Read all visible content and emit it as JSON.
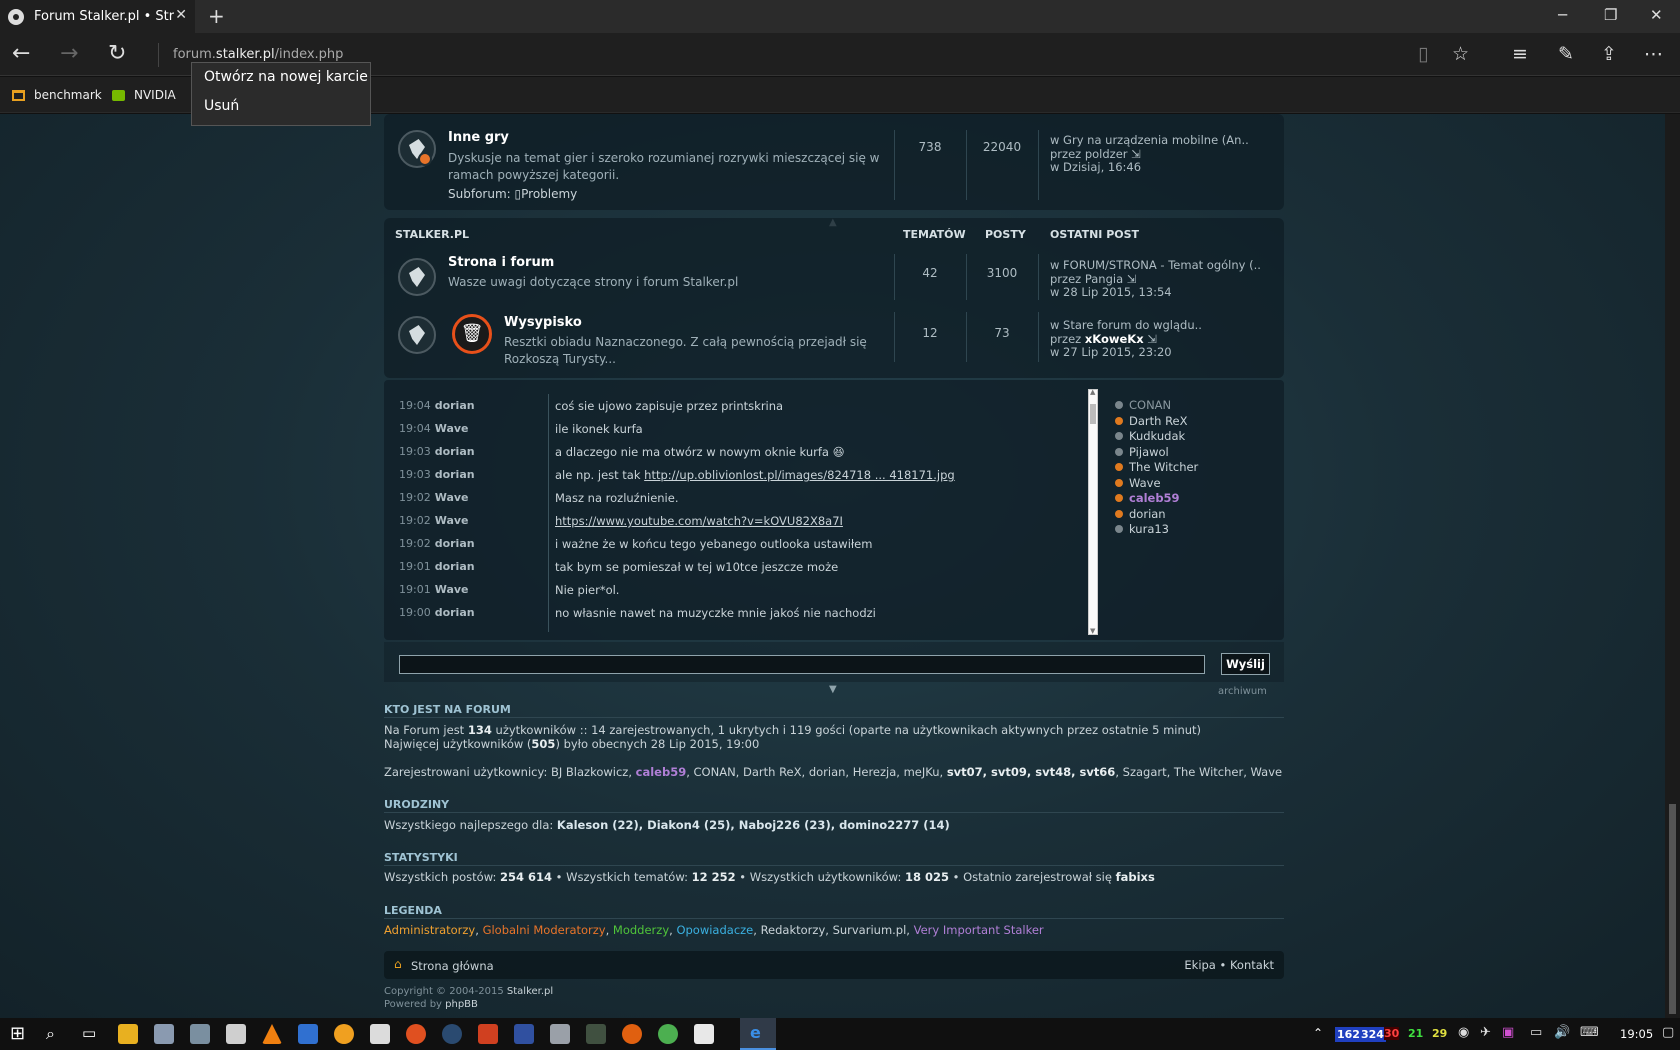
{
  "browser": {
    "tab_title": "Forum Stalker.pl • Strona",
    "url_prefix": "forum.",
    "url_domain": "stalker.pl",
    "url_path": "/index.php",
    "favorites": [
      "benchmark",
      "NVIDIA"
    ],
    "context_menu": [
      "Otwórz na nowej karcie",
      "Usuń"
    ]
  },
  "forum_top": {
    "title": "Inne gry",
    "desc1": "Dyskusje na temat gier i szeroko rozumianej rozrywki mieszczącej się w",
    "desc2": "ramach powyższej kategorii.",
    "subforum_label": "Subforum:",
    "subforum": "Problemy",
    "topics": "738",
    "posts": "22040",
    "last1": "w Gry na urządzenia mobilne (An..",
    "last2_pre": "przez ",
    "last2_user": "poldzer",
    "last3": "w Dzisiaj, 16:46"
  },
  "category": {
    "name": "STALKER.PL",
    "col_topics": "TEMATÓW",
    "col_posts": "POSTY",
    "col_last": "OSTATNI POST"
  },
  "forums": [
    {
      "title": "Strona i forum",
      "desc1": "Wasze uwagi dotyczące strony i forum Stalker.pl",
      "desc2": "",
      "topics": "42",
      "posts": "3100",
      "last1": "w FORUM/STRONA - Temat ogólny (..",
      "last2_pre": "przez ",
      "last2_user": "Pangia",
      "last3": "w 28 Lip 2015, 13:54"
    },
    {
      "title": "Wysypisko",
      "desc1": "Resztki obiadu Naznaczonego. Z całą pewnością przejadł się",
      "desc2": "Rozkoszą Turysty...",
      "topics": "12",
      "posts": "73",
      "last1": "w Stare forum do wglądu..",
      "last2_pre": "przez ",
      "last2_user": "xKoweKx",
      "last3": "w 27 Lip 2015, 23:20"
    }
  ],
  "chat": [
    {
      "time": "19:04",
      "user": "dorian",
      "msg": "coś sie ujowo zapisuje przez printskrina"
    },
    {
      "time": "19:04",
      "user": "Wave",
      "msg": "ile ikonek kurfa"
    },
    {
      "time": "19:03",
      "user": "dorian",
      "msg": "a dlaczego nie ma otwórz w nowym oknie kurfa 😆"
    },
    {
      "time": "19:03",
      "user": "dorian",
      "msg_pre": "ale np. jest tak ",
      "msg_link": "http://up.oblivionlost.pl/images/824718 ... 418171.jpg"
    },
    {
      "time": "19:02",
      "user": "Wave",
      "msg": "Masz na rozluźnienie."
    },
    {
      "time": "19:02",
      "user": "Wave",
      "msg_link": "https://www.youtube.com/watch?v=kOVU82X8a7I"
    },
    {
      "time": "19:02",
      "user": "dorian",
      "msg": "i ważne że w końcu tego yebanego outlooka ustawiłem"
    },
    {
      "time": "19:01",
      "user": "dorian",
      "msg": "tak bym se pomieszał w tej w10tce jeszcze może"
    },
    {
      "time": "19:01",
      "user": "Wave",
      "msg": "Nie pier*ol."
    },
    {
      "time": "19:00",
      "user": "dorian",
      "msg": "no własnie nawet na muzyczke mnie jakoś nie nachodzi"
    }
  ],
  "online_users": [
    {
      "name": "CONAN",
      "color": "#8a98a0",
      "dot": "#7a868c"
    },
    {
      "name": "Darth ReX",
      "color": "#c9d3d8",
      "dot": "#e07a1f"
    },
    {
      "name": "Kudkudak",
      "color": "#c9d3d8",
      "dot": "#7a868c"
    },
    {
      "name": "Pijawol",
      "color": "#c9d3d8",
      "dot": "#7a868c"
    },
    {
      "name": "The Witcher",
      "color": "#c9d3d8",
      "dot": "#e07a1f"
    },
    {
      "name": "Wave",
      "color": "#c9d3d8",
      "dot": "#e07a1f"
    },
    {
      "name": "caleb59",
      "color": "#b07fd6",
      "dot": "#e07a1f"
    },
    {
      "name": "dorian",
      "color": "#c9d3d8",
      "dot": "#e07a1f"
    },
    {
      "name": "kura13",
      "color": "#c9d3d8",
      "dot": "#7a868c"
    }
  ],
  "chat_send": "Wyślij",
  "chat_archive": "archiwum",
  "who": {
    "title": "KTO JEST NA FORUM",
    "line1_a": "Na Forum jest ",
    "line1_b": "134",
    "line1_c": " użytkowników :: 14 zarejestrowanych, 1 ukrytych i 119 gości (oparte na użytkownikach aktywnych przez ostatnie 5 minut)",
    "line2_a": "Najwięcej użytkowników (",
    "line2_b": "505",
    "line2_c": ") było obecnych 28 Lip 2015, 19:00",
    "registered_label": "Zarejestrowani użytkownicy: BJ Blazkowicz, ",
    "registered_purple": "caleb59",
    "registered_mid": ", CONAN, Darth ReX, dorian, Herezja, meJKu, ",
    "registered_bold": "svt07, svt09, svt48, svt66",
    "registered_end": ", Szagart, The Witcher, Wave"
  },
  "birthdays": {
    "title": "URODZINY",
    "text": "Wszystkiego najlepszego dla: ",
    "names": "Kaleson (22), Diakon4 (25), Naboj226 (23), domino2277 (14)"
  },
  "stats": {
    "title": "STATYSTYKI",
    "a": "Wszystkich postów: ",
    "a_v": "254 614",
    "b": " • Wszystkich tematów: ",
    "b_v": "12 252",
    "c": " • Wszystkich użytkowników: ",
    "c_v": "18 025",
    "d": " • Ostatnio zarejestrował się ",
    "d_v": "fabixs"
  },
  "legend": {
    "title": "LEGENDA",
    "groups": [
      {
        "name": "Administratorzy",
        "color": "#f0a030"
      },
      {
        "name": "Globalni Moderatorzy",
        "color": "#e8742a"
      },
      {
        "name": "Modderzy",
        "color": "#4fc43a"
      },
      {
        "name": "Opowiadacze",
        "color": "#3ab0e0"
      },
      {
        "name": "Redaktorzy",
        "color": "#c9d3d8"
      },
      {
        "name": "Survarium.pl",
        "color": "#c9d3d8"
      },
      {
        "name": "Very Important Stalker",
        "color": "#b07fd6"
      }
    ]
  },
  "footer": {
    "home": "Strona główna",
    "team": "Ekipa",
    "sep": "•",
    "contact": "Kontakt",
    "copyright_pre": "Copyright © 2004-2015 ",
    "copyright_link": "Stalker.pl",
    "powered_pre": "Powered by ",
    "powered_link": "phpBB"
  },
  "taskbar": {
    "clock": "19:05",
    "tray": [
      "162",
      "324",
      "30",
      "21",
      "29"
    ]
  }
}
